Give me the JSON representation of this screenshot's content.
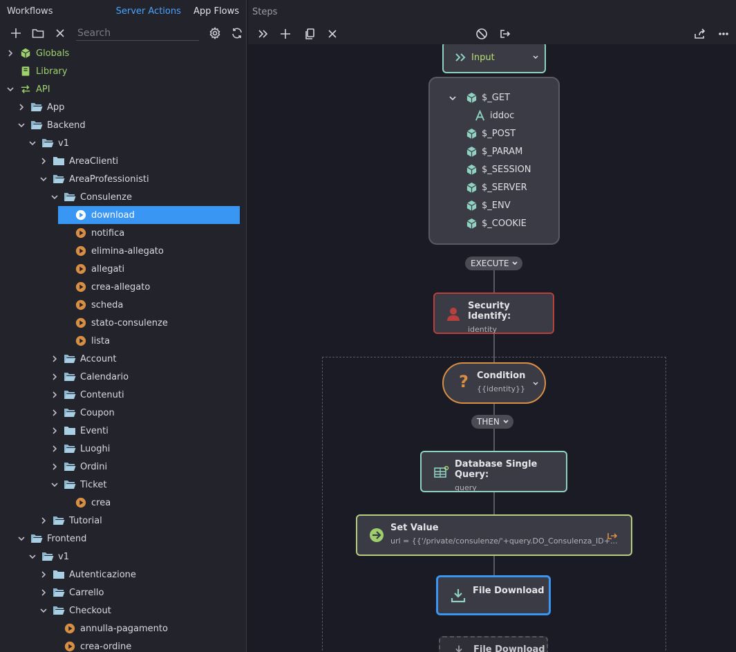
{
  "left_panel": {
    "title": "Workflows",
    "tabs": [
      "Server Actions",
      "App Flows"
    ],
    "search_placeholder": "Search",
    "tree": [
      {
        "label": "Globals",
        "indent": 0,
        "chev": "right",
        "icon": "cube-green",
        "green": true
      },
      {
        "label": "Library",
        "indent": 0,
        "chev": "",
        "icon": "book",
        "green": true
      },
      {
        "label": "API",
        "indent": 0,
        "chev": "down",
        "icon": "api",
        "green": true
      },
      {
        "label": "App",
        "indent": 1,
        "chev": "right",
        "icon": "folder-open"
      },
      {
        "label": "Backend",
        "indent": 1,
        "chev": "down",
        "icon": "folder-open"
      },
      {
        "label": "v1",
        "indent": 2,
        "chev": "down",
        "icon": "folder-open"
      },
      {
        "label": "AreaClienti",
        "indent": 3,
        "chev": "right",
        "icon": "folder"
      },
      {
        "label": "AreaProfessionisti",
        "indent": 3,
        "chev": "down",
        "icon": "folder-open"
      },
      {
        "label": "Consulenze",
        "indent": 4,
        "chev": "down",
        "icon": "folder-open"
      },
      {
        "label": "download",
        "indent": 5,
        "chev": "",
        "icon": "play-selected",
        "selected": true
      },
      {
        "label": "notifica",
        "indent": 5,
        "chev": "",
        "icon": "play"
      },
      {
        "label": "elimina-allegato",
        "indent": 5,
        "chev": "",
        "icon": "play"
      },
      {
        "label": "allegati",
        "indent": 5,
        "chev": "",
        "icon": "play"
      },
      {
        "label": "crea-allegato",
        "indent": 5,
        "chev": "",
        "icon": "play"
      },
      {
        "label": "scheda",
        "indent": 5,
        "chev": "",
        "icon": "play"
      },
      {
        "label": "stato-consulenze",
        "indent": 5,
        "chev": "",
        "icon": "play"
      },
      {
        "label": "lista",
        "indent": 5,
        "chev": "",
        "icon": "play"
      },
      {
        "label": "Account",
        "indent": 4,
        "chev": "right",
        "icon": "folder-open"
      },
      {
        "label": "Calendario",
        "indent": 4,
        "chev": "right",
        "icon": "folder-open"
      },
      {
        "label": "Contenuti",
        "indent": 4,
        "chev": "right",
        "icon": "folder-open"
      },
      {
        "label": "Coupon",
        "indent": 4,
        "chev": "right",
        "icon": "folder-open"
      },
      {
        "label": "Eventi",
        "indent": 4,
        "chev": "right",
        "icon": "folder"
      },
      {
        "label": "Luoghi",
        "indent": 4,
        "chev": "right",
        "icon": "folder-open"
      },
      {
        "label": "Ordini",
        "indent": 4,
        "chev": "right",
        "icon": "folder-open"
      },
      {
        "label": "Ticket",
        "indent": 4,
        "chev": "down",
        "icon": "folder-open"
      },
      {
        "label": "crea",
        "indent": 5,
        "chev": "",
        "icon": "play"
      },
      {
        "label": "Tutorial",
        "indent": 3,
        "chev": "right",
        "icon": "folder-open"
      },
      {
        "label": "Frontend",
        "indent": 1,
        "chev": "down",
        "icon": "folder-open"
      },
      {
        "label": "v1",
        "indent": 2,
        "chev": "down",
        "icon": "folder-open"
      },
      {
        "label": "Autenticazione",
        "indent": 3,
        "chev": "right",
        "icon": "folder"
      },
      {
        "label": "Carrello",
        "indent": 3,
        "chev": "right",
        "icon": "folder-open"
      },
      {
        "label": "Checkout",
        "indent": 3,
        "chev": "down",
        "icon": "folder-open"
      },
      {
        "label": "annulla-pagamento",
        "indent": 4,
        "chev": "",
        "icon": "play"
      },
      {
        "label": "crea-ordine",
        "indent": 4,
        "chev": "",
        "icon": "play"
      }
    ]
  },
  "right_panel": {
    "title": "Steps",
    "input_node": {
      "label": "Input"
    },
    "input_items": [
      "$_GET",
      "iddoc",
      "$_POST",
      "$_PARAM",
      "$_SESSION",
      "$_SERVER",
      "$_ENV",
      "$_COOKIE"
    ],
    "execute_label": "EXECUTE",
    "security": {
      "title": "Security Identify:",
      "sub": "identity"
    },
    "condition": {
      "title": "Condition",
      "sub": "{{identity}}"
    },
    "then_label": "THEN",
    "db_query": {
      "title": "Database Single Query:",
      "sub": "query"
    },
    "set_value": {
      "title": "Set Value",
      "sub": "url = {{'/private/consulenze/'+query.DO_Consulenza_ID+..."
    },
    "file_download": {
      "title": "File Download"
    },
    "file_download_ghost": {
      "title": "File Download"
    }
  },
  "colors": {
    "accent_blue": "#3a96f3",
    "green_text": "#9fd26d",
    "orange": "#d98f43",
    "security_red": "#b8403d",
    "teal_border": "#8fd2c1",
    "set_value_border": "#b9cd7f"
  }
}
